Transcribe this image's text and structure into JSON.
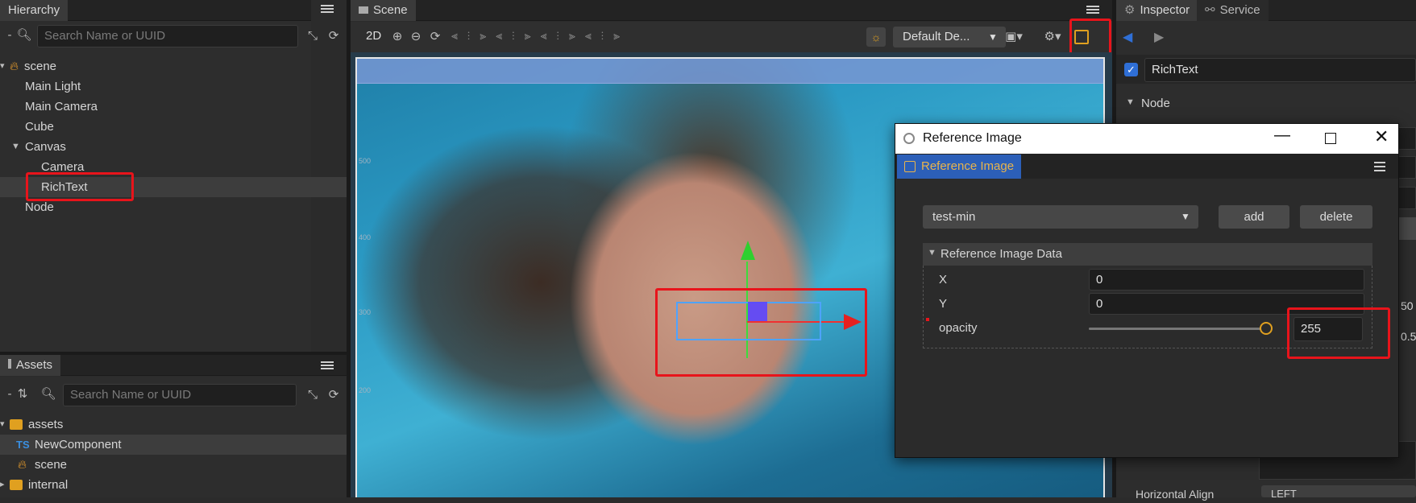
{
  "hierarchy": {
    "tab_label": "Hierarchy",
    "search_placeholder": "Search Name or UUID",
    "items": [
      {
        "label": "scene"
      },
      {
        "label": "Main Light"
      },
      {
        "label": "Main Camera"
      },
      {
        "label": "Cube"
      },
      {
        "label": "Canvas"
      },
      {
        "label": "Camera"
      },
      {
        "label": "RichText"
      },
      {
        "label": "Node"
      }
    ]
  },
  "assets": {
    "tab_label": "Assets",
    "search_placeholder": "Search Name or UUID",
    "items": [
      {
        "label": "assets"
      },
      {
        "label": "NewComponent",
        "badge": "TS"
      },
      {
        "label": "scene"
      },
      {
        "label": "internal"
      }
    ]
  },
  "scene": {
    "tab_label": "Scene",
    "mode_2d": "2D",
    "camera_select": "Default De...",
    "ruler_labels": [
      "500",
      "400",
      "300",
      "200"
    ]
  },
  "inspector": {
    "tab_inspector": "Inspector",
    "tab_service": "Service",
    "node_name": "RichText",
    "section_node": "Node",
    "partial_values": [
      "50",
      "0.5"
    ],
    "horizontal_align_label": "Horizontal Align",
    "horizontal_align_value": "LEFT"
  },
  "ref_window": {
    "title": "Reference Image",
    "panel_tab": "Reference Image",
    "select_value": "test-min",
    "add_label": "add",
    "delete_label": "delete",
    "section_title": "Reference Image Data",
    "x_label": "X",
    "x_value": "0",
    "y_label": "Y",
    "y_value": "0",
    "opacity_label": "opacity",
    "opacity_value": "255",
    "opacity_level": 1.0
  },
  "colors": {
    "highlight": "#e8141b",
    "accent_blue": "#2f6fd6",
    "accent_orange": "#e0a020"
  }
}
